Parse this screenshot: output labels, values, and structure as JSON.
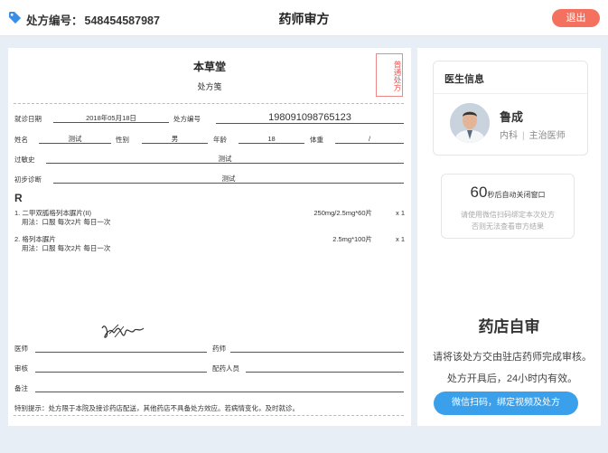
{
  "header": {
    "rx_number_label": "处方编号：",
    "rx_number": "548454587987",
    "title": "药师审方",
    "logout_label": "退出"
  },
  "prescription": {
    "pharmacy_name": "本草堂",
    "subtitle": "处方笺",
    "stamp_text": "普通处方",
    "visit_date_label": "就诊日期",
    "visit_date": "2018年05月18日",
    "rx_code_label": "处方编号",
    "rx_code": "198091098765123",
    "name_label": "姓名",
    "name": "测试",
    "gender_label": "性别",
    "gender": "男",
    "age_label": "年龄",
    "age": "18",
    "weight_label": "体重",
    "weight": "/",
    "allergy_label": "过敏史",
    "allergy": "测试",
    "diagnosis_label": "初步诊断",
    "diagnosis": "测试",
    "r_mark": "R",
    "drugs": [
      {
        "name": "1. 二甲双胍格列本脲片(II)",
        "usage": "用法：口服 每次2片 每日一次",
        "spec": "250mg/2.5mg*60片",
        "qty": "x 1"
      },
      {
        "name": "2. 格列本脲片",
        "usage": "用法：口服 每次2片 每日一次",
        "spec": "2.5mg*100片",
        "qty": "x 1"
      }
    ],
    "doctor_label": "医师",
    "pharmacist_label": "药师",
    "review_label": "审核",
    "dispenser_label": "配药人员",
    "remark_label": "备注",
    "notice": "特别提示：处方限于本院及接诊药店配送，其他药店不具备处方效应。若病情变化，及时就诊。"
  },
  "doctor_info": {
    "header": "医生信息",
    "name": "鲁成",
    "department": "内科",
    "title": "主治医师"
  },
  "timer": {
    "seconds": "60",
    "suffix": "秒后自动关闭窗口",
    "hint_line1": "请使用微信扫码绑定本次处方",
    "hint_line2": "否则无法查看审方结果"
  },
  "self_review": {
    "title": "药店自审",
    "line1": "请将该处方交由驻店药师完成审核。",
    "line2": "处方开具后，24小时内有效。",
    "button_label": "微信扫码，绑定视频及处方"
  },
  "colors": {
    "logout_button": "#f4715f",
    "wechat_button": "#3aa0ec",
    "stamp": "#e55555",
    "tag_icon": "#3a8ee6"
  }
}
